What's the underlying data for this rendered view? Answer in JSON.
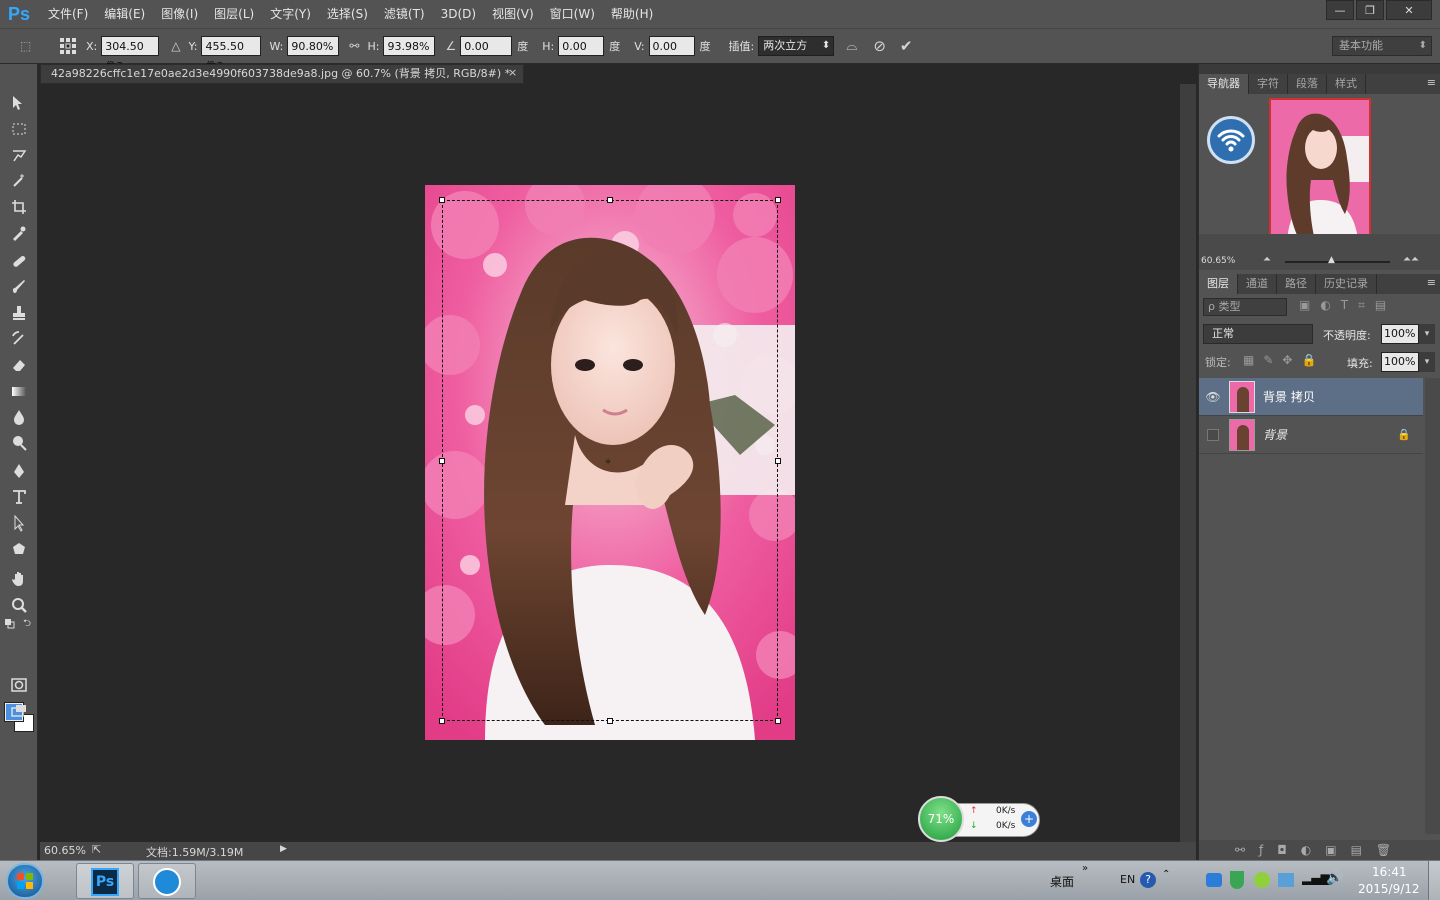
{
  "app": {
    "logo": "Ps"
  },
  "menu": [
    "文件(F)",
    "编辑(E)",
    "图像(I)",
    "图层(L)",
    "文字(Y)",
    "选择(S)",
    "滤镜(T)",
    "3D(D)",
    "视图(V)",
    "窗口(W)",
    "帮助(H)"
  ],
  "window_controls": {
    "minimize": "—",
    "restore": "❐",
    "close": "✕"
  },
  "options": {
    "x_label": "X:",
    "x_value": "304.50 像3",
    "y_label": "Y:",
    "y_value": "455.50 像3",
    "w_label": "W:",
    "w_value": "90.80%",
    "h_label": "H:",
    "h_value": "93.98%",
    "angle_value": "0.00",
    "angle_unit": "度",
    "hskew_label": "H:",
    "hskew_value": "0.00",
    "hskew_unit": "度",
    "vskew_label": "V:",
    "vskew_value": "0.00",
    "vskew_unit": "度",
    "interp_label": "插值:",
    "interp_value": "两次立方",
    "workspace": "基本功能"
  },
  "document": {
    "tab_title": "42a98226cffc1e17e0ae2d3e4990f603738de9a8.jpg @ 60.7% (背景 拷贝, RGB/8#) *",
    "close": "×",
    "zoom": "60.65%",
    "doc_size": "文档:1.59M/3.19M"
  },
  "navigator": {
    "tabs": [
      "导航器",
      "字符",
      "段落",
      "样式"
    ],
    "zoom": "60.65%"
  },
  "layers_panel": {
    "tabs": [
      "图层",
      "通道",
      "路径",
      "历史记录"
    ],
    "filter": "ρ 类型",
    "blend_mode": "正常",
    "opacity_label": "不透明度:",
    "opacity_value": "100%",
    "lock_label": "锁定:",
    "fill_label": "填充:",
    "fill_value": "100%",
    "layers": [
      {
        "name": "背景 拷贝",
        "visible": true,
        "selected": true,
        "locked": false
      },
      {
        "name": "背景",
        "visible": false,
        "selected": false,
        "locked": true
      }
    ]
  },
  "net_widget": {
    "percent": "71%",
    "up": "0K/s",
    "down": "0K/s"
  },
  "taskbar": {
    "desktop_label": "桌面",
    "lang": "EN",
    "time": "16:41",
    "date": "2015/9/12"
  },
  "colors": {
    "accent": "#34a8ff",
    "foreground_swatch": "#4a8fe0",
    "selected_layer": "#5d6f86"
  }
}
